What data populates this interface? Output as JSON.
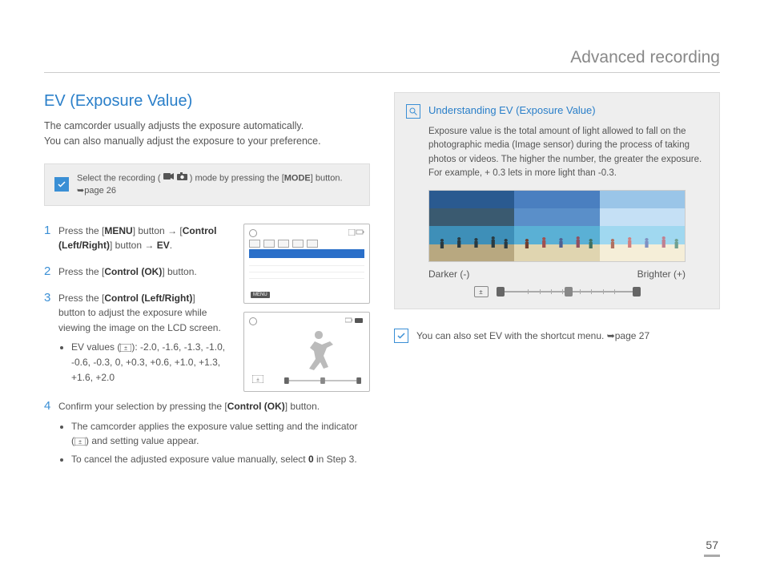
{
  "header": {
    "title": "Advanced recording"
  },
  "section": {
    "title": "EV (Exposure Value)",
    "intro_line1": "The camcorder usually adjusts the exposure automatically.",
    "intro_line2": "You can also manually adjust the exposure to your preference."
  },
  "note": {
    "pre": "Select the recording (",
    "post": ") mode by pressing the [",
    "mode_btn": "MODE",
    "tail": "] button. ➥page 26"
  },
  "steps": {
    "s1": {
      "num": "1",
      "t1": "Press the [",
      "b1": "MENU",
      "t2": "] button → [",
      "b2": "Control (Left/Right)",
      "t3": "] button → ",
      "b3": "EV",
      "t4": "."
    },
    "s2": {
      "num": "2",
      "t1": "Press the [",
      "b1": "Control (OK)",
      "t2": "] button."
    },
    "s3": {
      "num": "3",
      "t1": "Press the [",
      "b1": "Control (Left/Right)",
      "t2": "]",
      "body": "button to adjust the exposure while viewing the image on the LCD screen.",
      "bullet_label": "EV values (",
      "bullet_values": "): -2.0, -1.6, -1.3, -1.0, -0.6, -0.3, 0, +0.3, +0.6, +1.0, +1.3, +1.6, +2.0"
    },
    "s4": {
      "num": "4",
      "t1": "Confirm your selection by pressing the [",
      "b1": "Control (OK)",
      "t2": "] button.",
      "bullet1a": "The camcorder applies the exposure value setting and the indicator (",
      "bullet1b": ") and setting value appear.",
      "bullet2a": "To cancel the adjusted exposure value manually, select ",
      "bullet2_bold": "0",
      "bullet2b": " in Step 3."
    }
  },
  "lcd": {
    "menu": "MENU"
  },
  "info": {
    "title": "Understanding EV (Exposure Value)",
    "body": "Exposure value is the total amount of light allowed to fall on the photographic media (Image sensor) during the process of taking photos or videos. The higher the number, the greater the exposure. For example, + 0.3 lets in more light than -0.3.",
    "darker": "Darker (-)",
    "brighter": "Brighter (+)"
  },
  "footnote": {
    "text": "You can also set EV with the shortcut menu. ➥page 27"
  },
  "page": "57"
}
